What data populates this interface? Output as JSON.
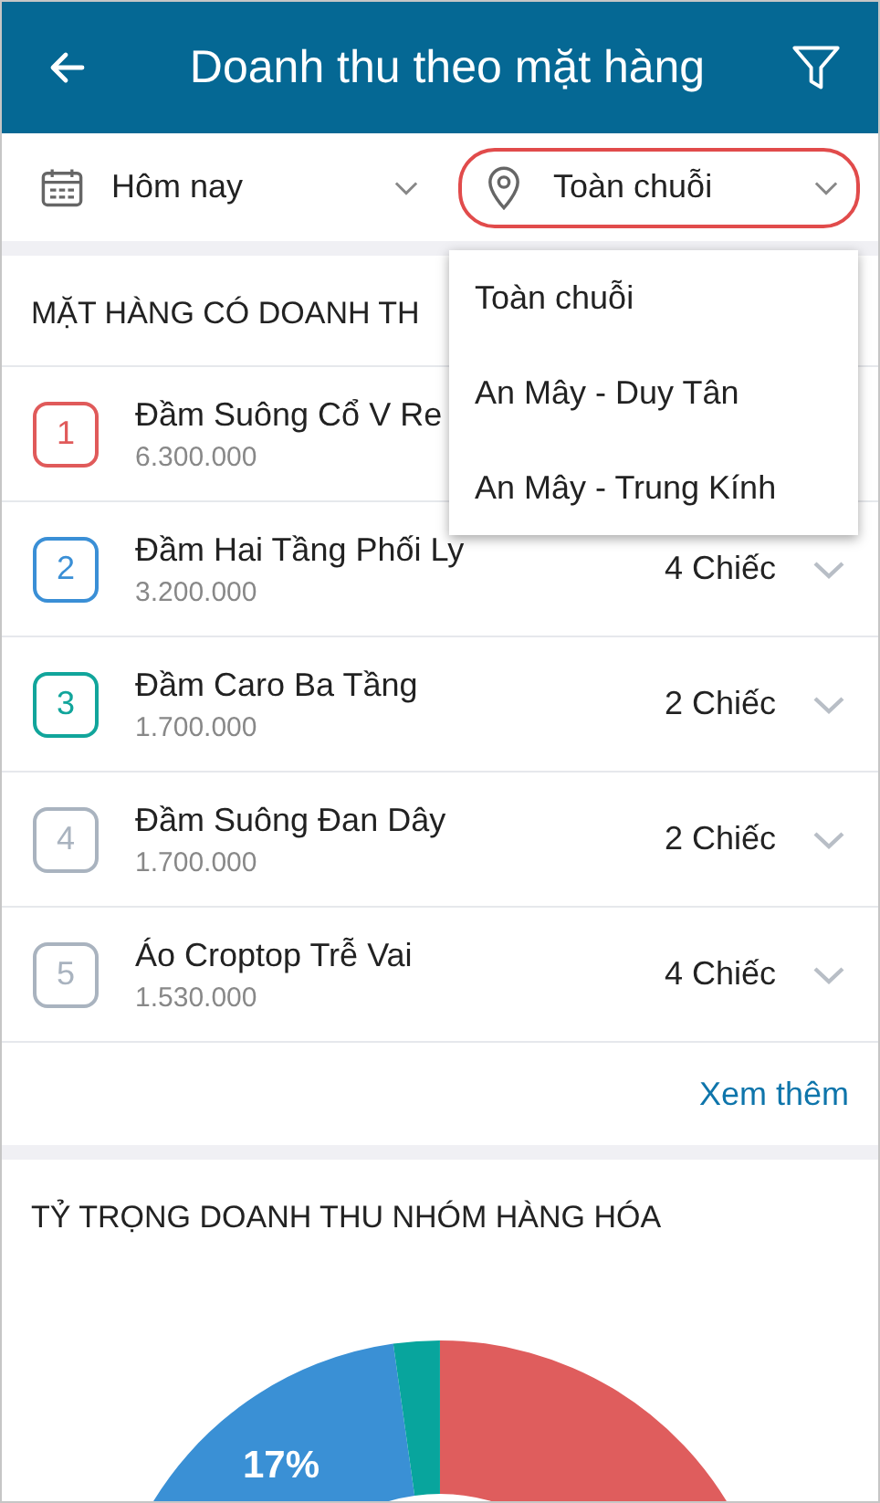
{
  "header": {
    "title": "Doanh thu theo mặt hàng"
  },
  "filters": {
    "date": {
      "value": "Hôm nay"
    },
    "location": {
      "value": "Toàn chuỗi",
      "highlighted": true,
      "open": true,
      "options": [
        "Toàn chuỗi",
        "An Mây - Duy Tân",
        "An Mây - Trung Kính"
      ]
    }
  },
  "top_items": {
    "title": "MẶT HÀNG CÓ DOANH TH",
    "rows": [
      {
        "rank": "1",
        "color": "#e05a5a",
        "name": "Đầm Suông Cổ V Re",
        "revenue": "6.300.000"
      },
      {
        "rank": "2",
        "color": "#3a8fd6",
        "name": "Đầm Hai Tầng Phối Ly",
        "revenue": "3.200.000",
        "quantity": "4 Chiếc"
      },
      {
        "rank": "3",
        "color": "#11a59b",
        "name": "Đầm Caro Ba Tầng",
        "revenue": "1.700.000",
        "quantity": "2 Chiếc"
      },
      {
        "rank": "4",
        "color": "#a9b3bf",
        "name": "Đầm Suông Đan Dây",
        "revenue": "1.700.000",
        "quantity": "2 Chiếc"
      },
      {
        "rank": "5",
        "color": "#a9b3bf",
        "name": "Áo Croptop Trễ Vai",
        "revenue": "1.530.000",
        "quantity": "4 Chiếc"
      }
    ],
    "more_link": "Xem thêm"
  },
  "group_share": {
    "title": "TỶ TRỌNG DOANH THU NHÓM HÀNG HÓA",
    "slice_label": "17%"
  }
}
